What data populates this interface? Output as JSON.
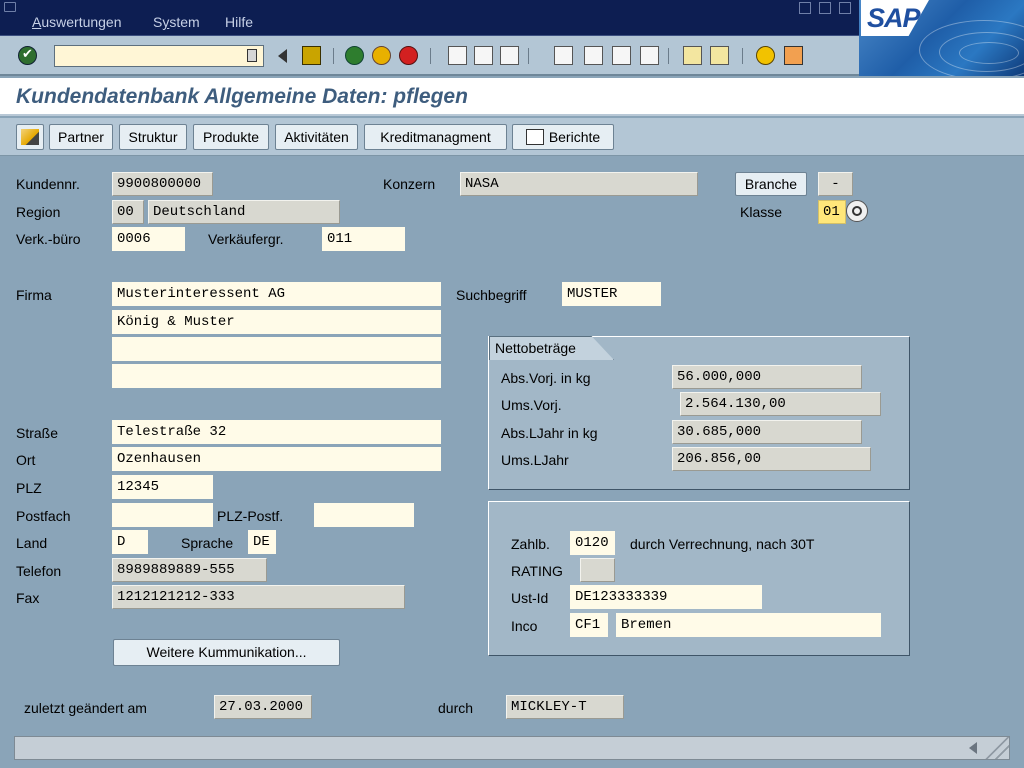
{
  "menu": {
    "items": [
      {
        "acc": "A",
        "rest": "uswertungen"
      },
      {
        "acc": "",
        "pre": "S",
        "acc2": "y",
        "rest": "stem"
      },
      {
        "acc": "",
        "rest": "Hilfe"
      }
    ]
  },
  "menu_labels": {
    "auswertungen_acc": "A",
    "auswertungen_rest": "uswertungen",
    "system_pre": "S",
    "system_acc": "y",
    "system_rest": "stem",
    "hilfe": "Hilfe"
  },
  "brand": {
    "logo": "SAP"
  },
  "toolbar": {
    "command_field": "",
    "icons": [
      "enter-icon",
      "back-icon",
      "save-icon",
      "navigate-back-icon",
      "exit-icon",
      "cancel-icon",
      "print-icon",
      "find-icon",
      "find-next-icon",
      "first-page-icon",
      "previous-page-icon",
      "next-page-icon",
      "last-page-icon",
      "create-session-icon",
      "shortcut-icon",
      "help-icon",
      "layout-icon"
    ]
  },
  "page": {
    "title": "Kundendatenbank Allgemeine Daten: pflegen"
  },
  "app_toolbar": {
    "partner": "Partner",
    "struktur": "Struktur",
    "produkte": "Produkte",
    "aktivitaeten": "Aktivitäten",
    "kredit": "Kreditmanagment",
    "berichte": "Berichte"
  },
  "form": {
    "kundennr_label": "Kundennr.",
    "kundennr": "9900800000",
    "konzern_label": "Konzern",
    "konzern": "NASA",
    "branche_button": "Branche",
    "branche": "-",
    "region_label": "Region",
    "region_code": "00",
    "region_name": "Deutschland",
    "klasse_label": "Klasse",
    "klasse": "01",
    "verkbuero_label": "Verk.-büro",
    "verkbuero": "0006",
    "verkaeufergr_label": "Verkäufergr.",
    "verkaeufergr": "011",
    "firma_label": "Firma",
    "firma1": "Musterinteressent AG",
    "firma2": "König & Muster",
    "firma3": "",
    "firma4": "",
    "suchbegriff_label": "Suchbegriff",
    "suchbegriff": "MUSTER",
    "strasse_label": "Straße",
    "strasse": "Telestraße 32",
    "ort_label": "Ort",
    "ort": "Ozenhausen",
    "plz_label": "PLZ",
    "plz": "12345",
    "postfach_label": "Postfach",
    "postfach": "",
    "plz_postf_label": "PLZ-Postf.",
    "plz_postf": "",
    "land_label": "Land",
    "land": "D",
    "sprache_label": "Sprache",
    "sprache": "DE",
    "telefon_label": "Telefon",
    "telefon": "8989889889-555",
    "fax_label": "Fax",
    "fax": "1212121212-333",
    "weitere_button": "Weitere Kummunikation...",
    "geaendert_label": "zuletzt geändert am",
    "geaendert": "27.03.2000",
    "durch_label": "durch",
    "durch": "MICKLEY-T"
  },
  "netto": {
    "title": "Nettobeträge",
    "abs_vorj_label": "Abs.Vorj. in kg",
    "abs_vorj": "56.000,000",
    "ums_vorj_label": "Ums.Vorj.",
    "ums_vorj": "2.564.130,00",
    "abs_ljahr_label": "Abs.LJahr in kg",
    "abs_ljahr": "30.685,000",
    "ums_ljahr_label": "Ums.LJahr",
    "ums_ljahr": "206.856,00"
  },
  "zahlung": {
    "zahlb_label": "Zahlb.",
    "zahlb": "0120",
    "zahlb_text": "durch Verrechnung, nach 30T",
    "rating_label": "RATING",
    "rating": "",
    "ustid_label": "Ust-Id",
    "ustid": "DE123333339",
    "inco_label": "Inco",
    "inco_code": "CF1",
    "inco_ort": "Bremen"
  },
  "status": {
    "message": ""
  },
  "colors": {
    "background": "#8aa4b8",
    "menubar": "#0d1e52",
    "title": "#3e5d7e",
    "input": "#fffbe8",
    "readonly": "#d8d8d0",
    "highlight": "#ffe77a"
  }
}
